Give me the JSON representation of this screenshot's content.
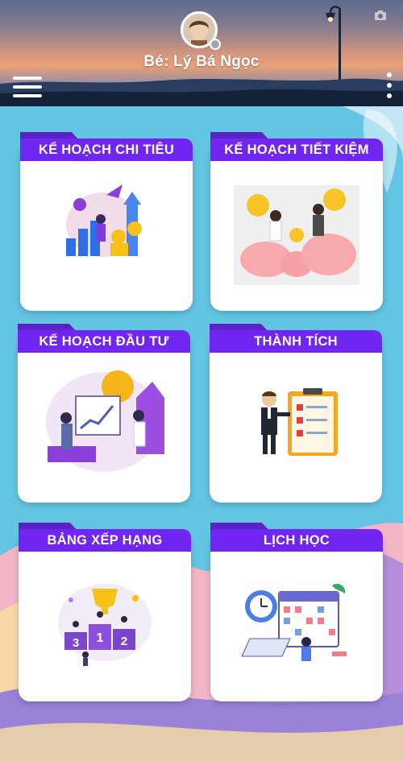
{
  "header": {
    "child_name": "Bé: Lý Bá Ngọc",
    "menu_icon": "hamburger-menu-icon",
    "more_icon": "vertical-dots-icon",
    "camera_icon": "camera-icon"
  },
  "cards": [
    {
      "title": "KẾ HOẠCH CHI TIÊU",
      "icon": "spending-plan-illustration"
    },
    {
      "title": "KẾ HOẠCH TIẾT KIỆM",
      "icon": "savings-plan-illustration"
    },
    {
      "title": "KẾ HOẠCH ĐẦU TƯ",
      "icon": "investment-plan-illustration"
    },
    {
      "title": "THÀNH TÍCH",
      "icon": "achievement-checklist-illustration"
    },
    {
      "title": "BẢNG XẾP HẠNG",
      "icon": "leaderboard-podium-illustration"
    },
    {
      "title": "LỊCH HỌC",
      "icon": "study-schedule-calendar-illustration"
    }
  ],
  "colors": {
    "title_bar": "#7125f0",
    "title_tab": "#5a23c4",
    "background": "#5fc3e0"
  }
}
